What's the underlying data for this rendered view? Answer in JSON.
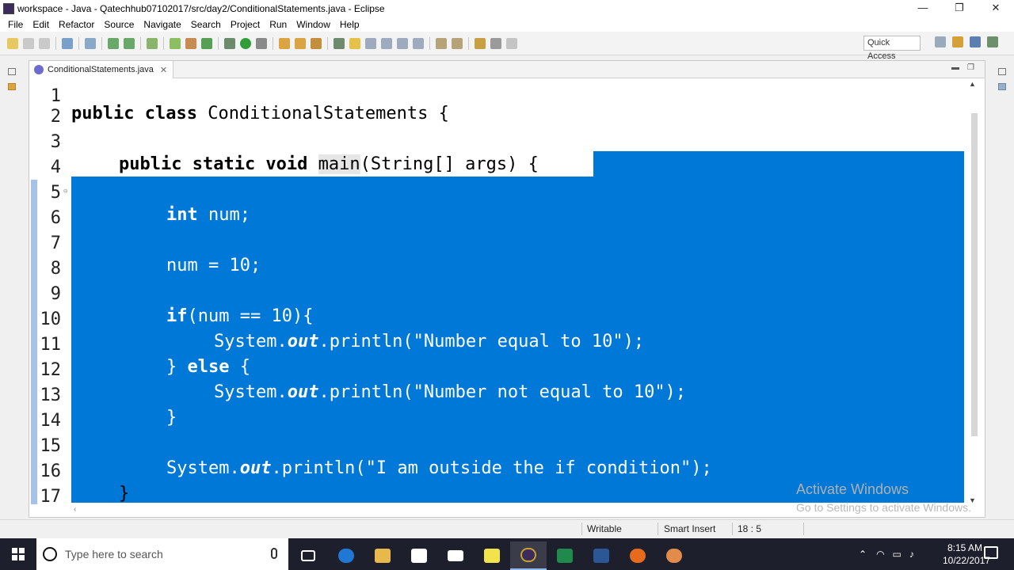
{
  "window": {
    "title": "workspace - Java - Qatechhub07102017/src/day2/ConditionalStatements.java - Eclipse",
    "minimize": "—",
    "restore": "❐",
    "close": "✕"
  },
  "menu": {
    "items": [
      "File",
      "Edit",
      "Refactor",
      "Source",
      "Navigate",
      "Search",
      "Project",
      "Run",
      "Window",
      "Help"
    ]
  },
  "toolbar": {
    "quick_access": "Quick Access"
  },
  "editor": {
    "tab_label": "ConditionalStatements.java",
    "tab_close": "✕",
    "line_numbers": [
      "1",
      "2",
      "3",
      "4",
      "5",
      "6",
      "7",
      "8",
      "9",
      "10",
      "11",
      "12",
      "13",
      "14",
      "15",
      "16",
      "17"
    ],
    "lines": {
      "l2_kw": "public class",
      "l2_rest": " ConditionalStatements {",
      "l4_kw": "public static void",
      "l4_main": "main",
      "l4_rest": "(String[] args) {",
      "l6_kw": "int",
      "l6_rest": " num;",
      "l8": "num = 10;",
      "l10_kw": "if",
      "l10_rest": "(num == 10){",
      "l11_a": "System.",
      "l11_out": "out",
      "l11_b": ".println(\"Number equal to 10\");",
      "l12_a": "} ",
      "l12_kw": "else",
      "l12_b": " {",
      "l13_a": "System.",
      "l13_out": "out",
      "l13_b": ".println(\"Number not equal to 10\");",
      "l14": "}",
      "l16_a": "System.",
      "l16_out": "out",
      "l16_b": ".println(\"I am outside the if condition\");",
      "l17": "}"
    },
    "selection_color": "#0078d7"
  },
  "watermark": {
    "line1": "Activate Windows",
    "line2": "Go to Settings to activate Windows."
  },
  "status": {
    "writable": "Writable",
    "insert_mode": "Smart Insert",
    "position": "18 : 5"
  },
  "taskbar": {
    "search_placeholder": "Type here to search",
    "time": "8:15 AM",
    "date": "10/22/2017"
  }
}
